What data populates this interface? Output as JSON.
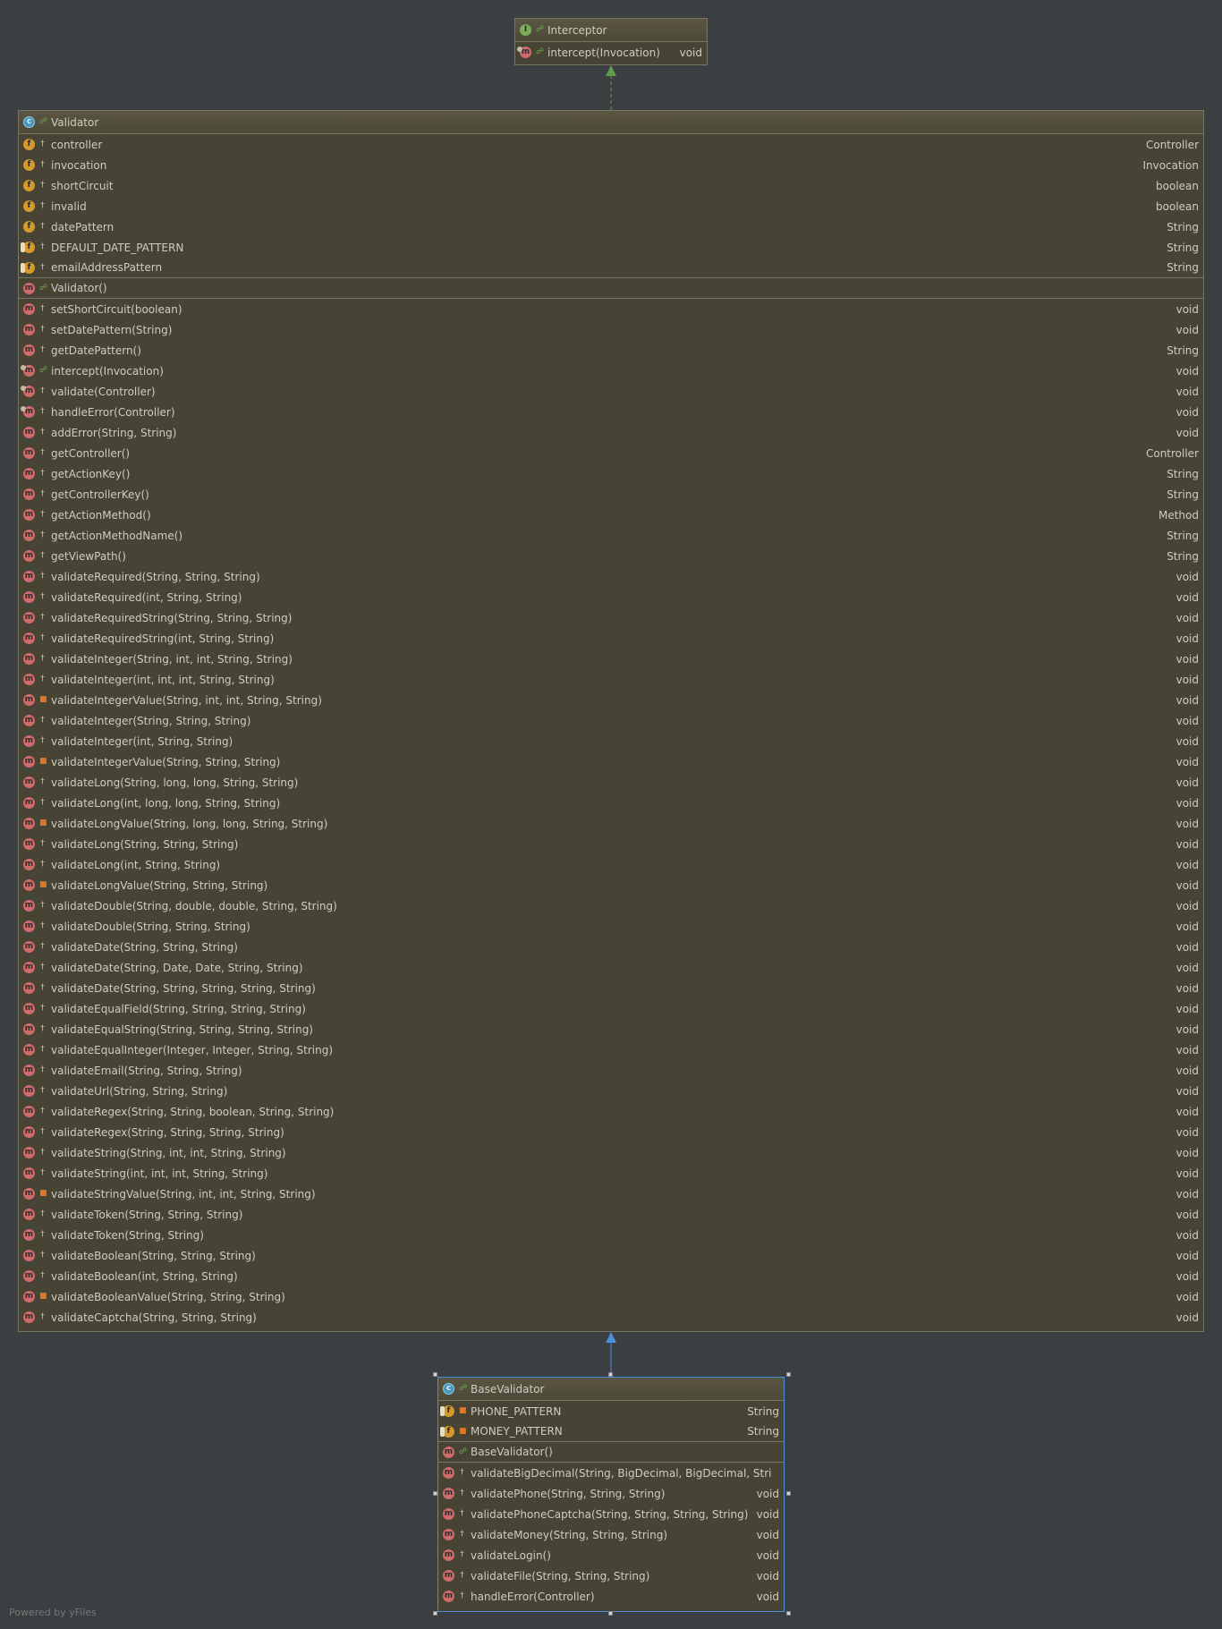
{
  "interceptor": {
    "name": "Interceptor",
    "methods": [
      {
        "name": "intercept(Invocation)",
        "type": "void",
        "kind": "am",
        "vis": "pub"
      }
    ]
  },
  "validator": {
    "name": "Validator",
    "fields": [
      {
        "name": "controller",
        "type": "Controller",
        "kind": "f",
        "vis": "prot"
      },
      {
        "name": "invocation",
        "type": "Invocation",
        "kind": "f",
        "vis": "prot"
      },
      {
        "name": "shortCircuit",
        "type": "boolean",
        "kind": "f",
        "vis": "prot"
      },
      {
        "name": "invalid",
        "type": "boolean",
        "kind": "f",
        "vis": "prot"
      },
      {
        "name": "datePattern",
        "type": "String",
        "kind": "f",
        "vis": "prot"
      },
      {
        "name": "DEFAULT_DATE_PATTERN",
        "type": "String",
        "kind": "cf",
        "vis": "prot"
      },
      {
        "name": "emailAddressPattern",
        "type": "String",
        "kind": "cf",
        "vis": "prot"
      }
    ],
    "constructors": [
      {
        "name": "Validator()",
        "type": "",
        "kind": "m",
        "vis": "pub"
      }
    ],
    "methods": [
      {
        "name": "setShortCircuit(boolean)",
        "type": "void",
        "kind": "m",
        "vis": "prot"
      },
      {
        "name": "setDatePattern(String)",
        "type": "void",
        "kind": "m",
        "vis": "prot"
      },
      {
        "name": "getDatePattern()",
        "type": "String",
        "kind": "m",
        "vis": "prot"
      },
      {
        "name": "intercept(Invocation)",
        "type": "void",
        "kind": "am",
        "vis": "pub"
      },
      {
        "name": "validate(Controller)",
        "type": "void",
        "kind": "am",
        "vis": "prot"
      },
      {
        "name": "handleError(Controller)",
        "type": "void",
        "kind": "am",
        "vis": "prot"
      },
      {
        "name": "addError(String, String)",
        "type": "void",
        "kind": "m",
        "vis": "prot"
      },
      {
        "name": "getController()",
        "type": "Controller",
        "kind": "m",
        "vis": "prot"
      },
      {
        "name": "getActionKey()",
        "type": "String",
        "kind": "m",
        "vis": "prot"
      },
      {
        "name": "getControllerKey()",
        "type": "String",
        "kind": "m",
        "vis": "prot"
      },
      {
        "name": "getActionMethod()",
        "type": "Method",
        "kind": "m",
        "vis": "prot"
      },
      {
        "name": "getActionMethodName()",
        "type": "String",
        "kind": "m",
        "vis": "prot"
      },
      {
        "name": "getViewPath()",
        "type": "String",
        "kind": "m",
        "vis": "prot"
      },
      {
        "name": "validateRequired(String, String, String)",
        "type": "void",
        "kind": "m",
        "vis": "prot"
      },
      {
        "name": "validateRequired(int, String, String)",
        "type": "void",
        "kind": "m",
        "vis": "prot"
      },
      {
        "name": "validateRequiredString(String, String, String)",
        "type": "void",
        "kind": "m",
        "vis": "prot"
      },
      {
        "name": "validateRequiredString(int, String, String)",
        "type": "void",
        "kind": "m",
        "vis": "prot"
      },
      {
        "name": "validateInteger(String, int, int, String, String)",
        "type": "void",
        "kind": "m",
        "vis": "prot"
      },
      {
        "name": "validateInteger(int, int, int, String, String)",
        "type": "void",
        "kind": "m",
        "vis": "prot"
      },
      {
        "name": "validateIntegerValue(String, int, int, String, String)",
        "type": "void",
        "kind": "m",
        "vis": "priv"
      },
      {
        "name": "validateInteger(String, String, String)",
        "type": "void",
        "kind": "m",
        "vis": "prot"
      },
      {
        "name": "validateInteger(int, String, String)",
        "type": "void",
        "kind": "m",
        "vis": "prot"
      },
      {
        "name": "validateIntegerValue(String, String, String)",
        "type": "void",
        "kind": "m",
        "vis": "priv"
      },
      {
        "name": "validateLong(String, long, long, String, String)",
        "type": "void",
        "kind": "m",
        "vis": "prot"
      },
      {
        "name": "validateLong(int, long, long, String, String)",
        "type": "void",
        "kind": "m",
        "vis": "prot"
      },
      {
        "name": "validateLongValue(String, long, long, String, String)",
        "type": "void",
        "kind": "m",
        "vis": "priv"
      },
      {
        "name": "validateLong(String, String, String)",
        "type": "void",
        "kind": "m",
        "vis": "prot"
      },
      {
        "name": "validateLong(int, String, String)",
        "type": "void",
        "kind": "m",
        "vis": "prot"
      },
      {
        "name": "validateLongValue(String, String, String)",
        "type": "void",
        "kind": "m",
        "vis": "priv"
      },
      {
        "name": "validateDouble(String, double, double, String, String)",
        "type": "void",
        "kind": "m",
        "vis": "prot"
      },
      {
        "name": "validateDouble(String, String, String)",
        "type": "void",
        "kind": "m",
        "vis": "prot"
      },
      {
        "name": "validateDate(String, String, String)",
        "type": "void",
        "kind": "m",
        "vis": "prot"
      },
      {
        "name": "validateDate(String, Date, Date, String, String)",
        "type": "void",
        "kind": "m",
        "vis": "prot"
      },
      {
        "name": "validateDate(String, String, String, String, String)",
        "type": "void",
        "kind": "m",
        "vis": "prot"
      },
      {
        "name": "validateEqualField(String, String, String, String)",
        "type": "void",
        "kind": "m",
        "vis": "prot"
      },
      {
        "name": "validateEqualString(String, String, String, String)",
        "type": "void",
        "kind": "m",
        "vis": "prot"
      },
      {
        "name": "validateEqualInteger(Integer, Integer, String, String)",
        "type": "void",
        "kind": "m",
        "vis": "prot"
      },
      {
        "name": "validateEmail(String, String, String)",
        "type": "void",
        "kind": "m",
        "vis": "prot"
      },
      {
        "name": "validateUrl(String, String, String)",
        "type": "void",
        "kind": "m",
        "vis": "prot"
      },
      {
        "name": "validateRegex(String, String, boolean, String, String)",
        "type": "void",
        "kind": "m",
        "vis": "prot"
      },
      {
        "name": "validateRegex(String, String, String, String)",
        "type": "void",
        "kind": "m",
        "vis": "prot"
      },
      {
        "name": "validateString(String, int, int, String, String)",
        "type": "void",
        "kind": "m",
        "vis": "prot"
      },
      {
        "name": "validateString(int, int, int, String, String)",
        "type": "void",
        "kind": "m",
        "vis": "prot"
      },
      {
        "name": "validateStringValue(String, int, int, String, String)",
        "type": "void",
        "kind": "m",
        "vis": "priv"
      },
      {
        "name": "validateToken(String, String, String)",
        "type": "void",
        "kind": "m",
        "vis": "prot"
      },
      {
        "name": "validateToken(String, String)",
        "type": "void",
        "kind": "m",
        "vis": "prot"
      },
      {
        "name": "validateBoolean(String, String, String)",
        "type": "void",
        "kind": "m",
        "vis": "prot"
      },
      {
        "name": "validateBoolean(int, String, String)",
        "type": "void",
        "kind": "m",
        "vis": "prot"
      },
      {
        "name": "validateBooleanValue(String, String, String)",
        "type": "void",
        "kind": "m",
        "vis": "priv"
      },
      {
        "name": "validateCaptcha(String, String, String)",
        "type": "void",
        "kind": "m",
        "vis": "prot"
      }
    ]
  },
  "baseValidator": {
    "name": "BaseValidator",
    "fields": [
      {
        "name": "PHONE_PATTERN",
        "type": "String",
        "kind": "cf",
        "vis": "priv"
      },
      {
        "name": "MONEY_PATTERN",
        "type": "String",
        "kind": "cf",
        "vis": "priv"
      }
    ],
    "constructors": [
      {
        "name": "BaseValidator()",
        "type": "",
        "kind": "m",
        "vis": "pub"
      }
    ],
    "methods": [
      {
        "name": "validateBigDecimal(String, BigDecimal, BigDecimal, String, S",
        "type": "",
        "kind": "m",
        "vis": "prot"
      },
      {
        "name": "validatePhone(String, String, String)",
        "type": "void",
        "kind": "m",
        "vis": "prot"
      },
      {
        "name": "validatePhoneCaptcha(String, String, String, String)",
        "type": "void",
        "kind": "m",
        "vis": "prot"
      },
      {
        "name": "validateMoney(String, String, String)",
        "type": "void",
        "kind": "m",
        "vis": "prot"
      },
      {
        "name": "validateLogin()",
        "type": "void",
        "kind": "m",
        "vis": "prot"
      },
      {
        "name": "validateFile(String, String, String)",
        "type": "void",
        "kind": "m",
        "vis": "prot"
      },
      {
        "name": "handleError(Controller)",
        "type": "void",
        "kind": "m",
        "vis": "prot"
      }
    ]
  },
  "footer": "Powered by yFiles",
  "colors": {
    "background": "#3c3f41",
    "node_fill": "#474335",
    "node_border": "#7a7462",
    "selected_border": "#4a8fd8",
    "realization_edge": "#5e9e4a",
    "generalization_edge": "#4a8fd8"
  }
}
